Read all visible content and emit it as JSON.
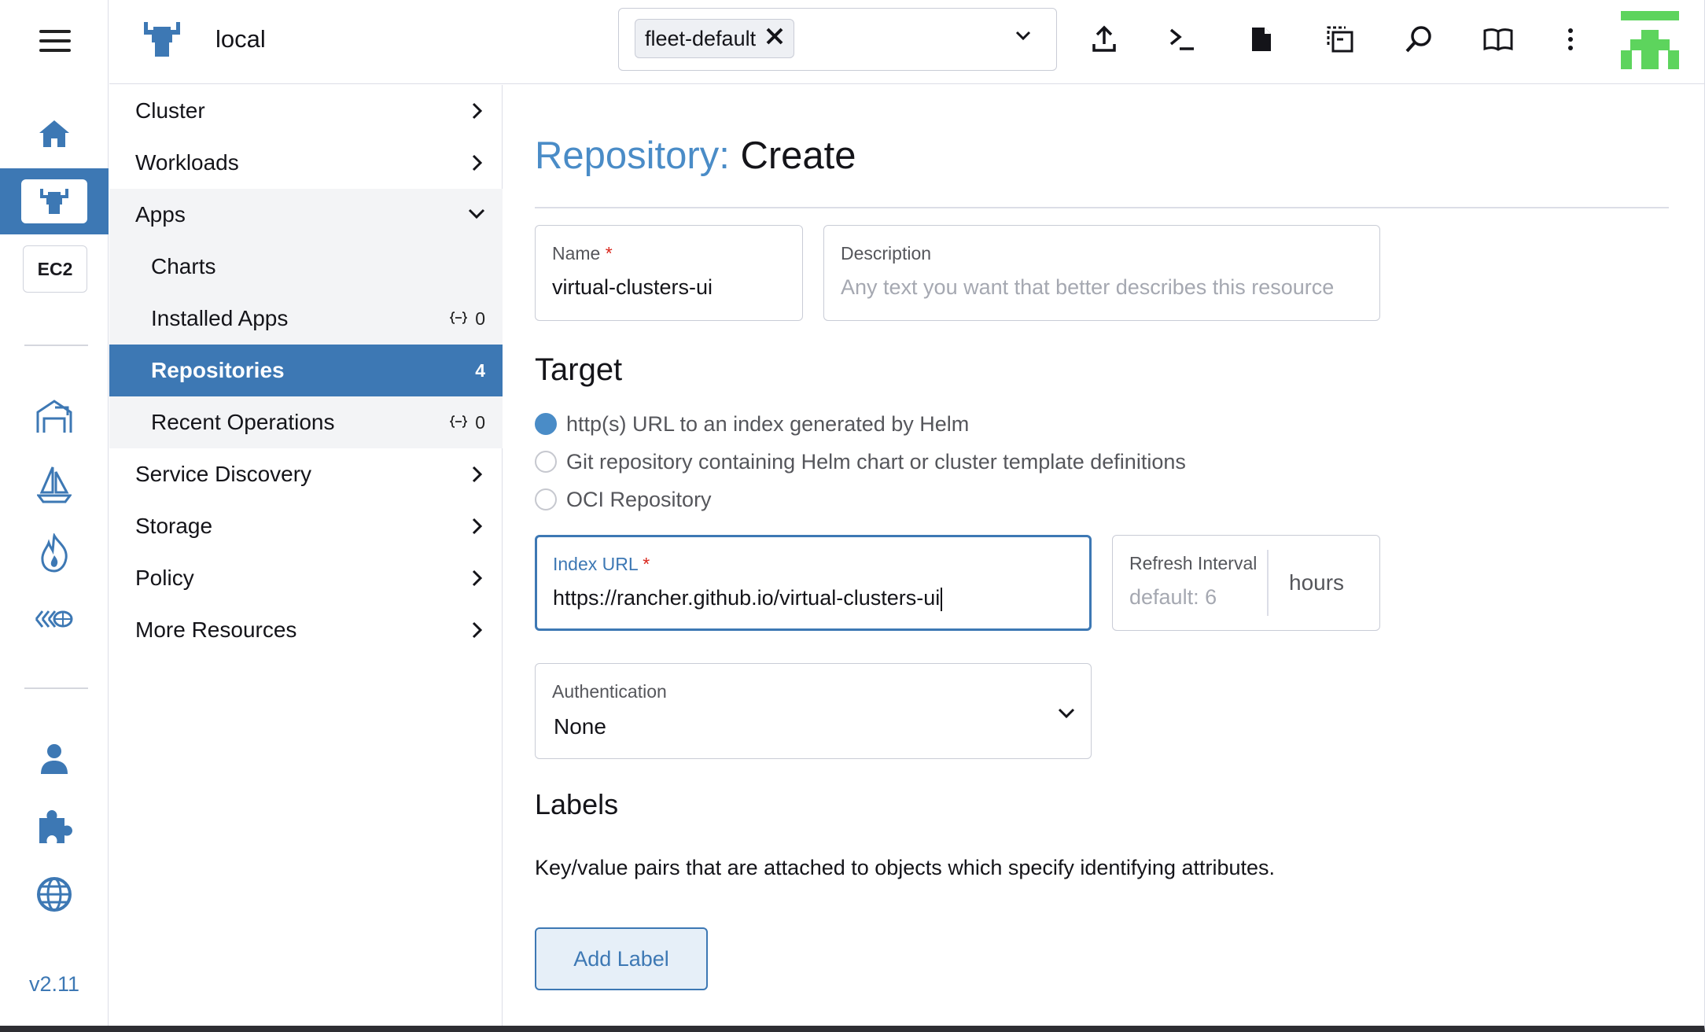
{
  "header": {
    "cluster_name": "local",
    "namespace_chip": "fleet-default"
  },
  "rail": {
    "active_item": "cluster-explorer",
    "ec2_label": "EC2",
    "version": "v2.11"
  },
  "sidenav": {
    "items": [
      {
        "label": "Cluster",
        "expanded": false
      },
      {
        "label": "Workloads",
        "expanded": false
      },
      {
        "label": "Apps",
        "expanded": true
      },
      {
        "label": "Service Discovery",
        "expanded": false
      },
      {
        "label": "Storage",
        "expanded": false
      },
      {
        "label": "Policy",
        "expanded": false
      },
      {
        "label": "More Resources",
        "expanded": false
      }
    ],
    "apps_children": [
      {
        "label": "Charts",
        "count": ""
      },
      {
        "label": "Installed Apps",
        "count": "0"
      },
      {
        "label": "Repositories",
        "count": "4",
        "selected": true
      },
      {
        "label": "Recent Operations",
        "count": "0"
      }
    ]
  },
  "page": {
    "title_type": "Repository:",
    "title_mode": "Create",
    "name_label": "Name",
    "name_value": "virtual-clusters-ui",
    "description_label": "Description",
    "description_placeholder": "Any text you want that better describes this resource",
    "target_heading": "Target",
    "target_options": [
      {
        "label": "http(s) URL to an index generated by Helm",
        "selected": true
      },
      {
        "label": "Git repository containing Helm chart or cluster template definitions",
        "selected": false
      },
      {
        "label": "OCI Repository",
        "selected": false
      }
    ],
    "index_url_label": "Index URL",
    "index_url_value": "https://rancher.github.io/virtual-clusters-ui",
    "refresh_label": "Refresh Interval",
    "refresh_placeholder": "default: 6",
    "refresh_unit": "hours",
    "auth_label": "Authentication",
    "auth_value": "None",
    "labels_heading": "Labels",
    "labels_help": "Key/value pairs that are attached to objects which specify identifying attributes.",
    "add_label_button": "Add Label"
  },
  "colors": {
    "accent": "#3d78b4",
    "title_accent": "#4a8cc7",
    "required": "#d9261c",
    "avatar_green": "#5dd45d"
  }
}
